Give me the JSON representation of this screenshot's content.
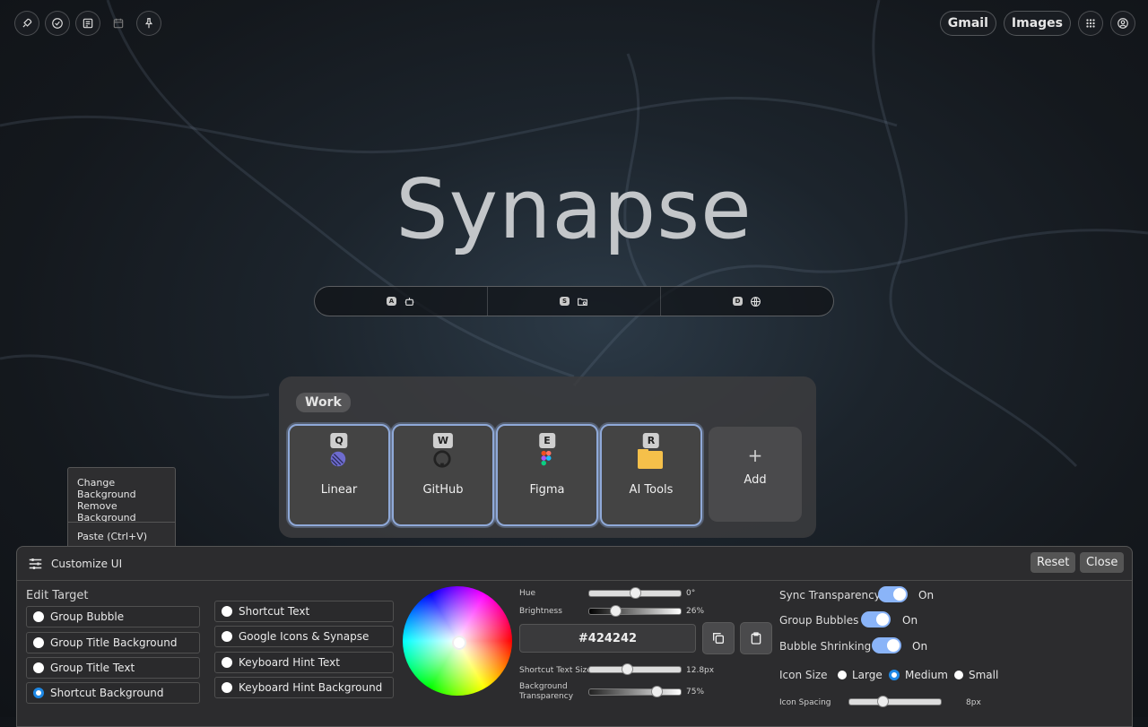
{
  "app": {
    "title": "Synapse"
  },
  "top_left_icons": [
    "rocket-icon",
    "check-circle-icon",
    "note-icon",
    "calendar-icon",
    "pin-icon"
  ],
  "top_right": {
    "gmail": "Gmail",
    "images": "Images"
  },
  "search": {
    "segments": [
      {
        "key": "A",
        "icon": "robot-icon"
      },
      {
        "key": "S",
        "icon": "folder-search-icon"
      },
      {
        "key": "D",
        "icon": "globe-icon"
      }
    ]
  },
  "group": {
    "title": "Work",
    "shortcuts": [
      {
        "hint": "Q",
        "label": "Linear",
        "icon": "linear-icon"
      },
      {
        "hint": "W",
        "label": "GitHub",
        "icon": "github-icon"
      },
      {
        "hint": "E",
        "label": "Figma",
        "icon": "figma-icon"
      },
      {
        "hint": "R",
        "label": "AI Tools",
        "icon": "folder-icon"
      }
    ],
    "add_label": "Add"
  },
  "context_menu": {
    "change_bg": "Change Background",
    "remove_bg": "Remove Background",
    "paste": "Paste (Ctrl+V)"
  },
  "customize": {
    "title": "Customize UI",
    "reset": "Reset",
    "close": "Close",
    "edit_target_label": "Edit Target",
    "targets_col1": [
      "Group Bubble",
      "Group Title Background",
      "Group Title Text",
      "Shortcut Background"
    ],
    "targets_col2": [
      "Shortcut Text",
      "Google Icons & Synapse",
      "Keyboard Hint Text",
      "Keyboard Hint Background"
    ],
    "selected_target": "Shortcut Background",
    "hue_label": "Hue",
    "hue_value": "0°",
    "hue_fraction": 0.5,
    "brightness_label": "Brightness",
    "brightness_value": "26%",
    "hex": "#424242",
    "shortcut_text_size_label": "Shortcut Text Size",
    "shortcut_text_size_value": "12.8px",
    "bg_transparency_label_1": "Background",
    "bg_transparency_label_2": "Transparency",
    "bg_transparency_value": "75%",
    "sync_transparency_label": "Sync Transparency",
    "sync_transparency_value": "On",
    "group_bubbles_label": "Group Bubbles",
    "group_bubbles_value": "On",
    "bubble_shrinking_label": "Bubble Shrinking",
    "bubble_shrinking_value": "On",
    "icon_size_label": "Icon Size",
    "icon_size_options": [
      "Large",
      "Medium",
      "Small"
    ],
    "icon_size_selected": "Medium",
    "icon_spacing_label": "Icon Spacing",
    "icon_spacing_value": "8px",
    "accent_color": "#8ab4f8",
    "radio_color": "#1e88e5"
  }
}
